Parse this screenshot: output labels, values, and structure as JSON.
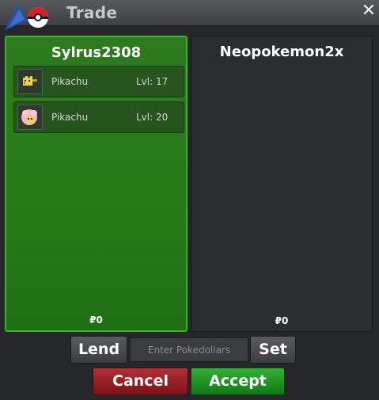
{
  "window": {
    "title": "Trade",
    "close_label": "✕"
  },
  "left_panel": {
    "player": "Sylrus2308",
    "money": "₽0",
    "pokemon": [
      {
        "name": "Pikachu",
        "level": "Lvl: 17"
      },
      {
        "name": "Pikachu",
        "level": "Lvl: 20"
      }
    ]
  },
  "right_panel": {
    "player": "Neopokemon2x",
    "money": "₽0"
  },
  "controls": {
    "lend_label": "Lend",
    "amount_placeholder": "Enter Pokedollars",
    "set_label": "Set",
    "cancel_label": "Cancel",
    "accept_label": "Accept"
  },
  "colors": {
    "accent_green": "#3cb32a",
    "cancel_red": "#b32f36",
    "accept_green": "#32b035"
  }
}
